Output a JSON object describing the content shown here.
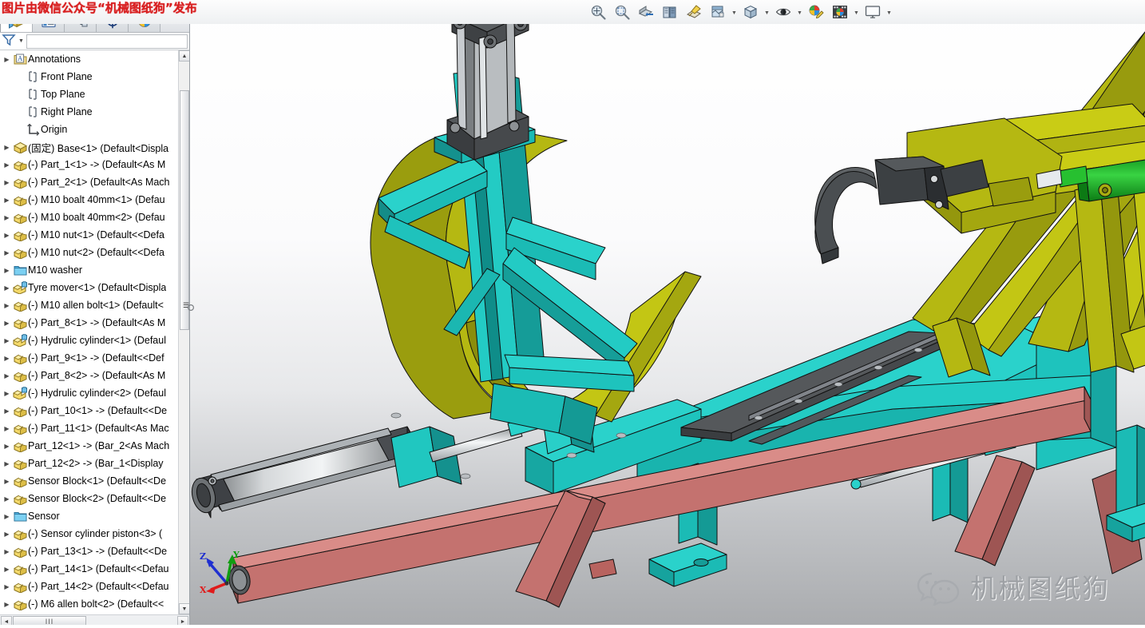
{
  "banner": {
    "text": "图片由微信公众号“机械图纸狗”发布",
    "color": "#d81f20"
  },
  "toolbar": {
    "buttons": [
      {
        "name": "zoom-to-fit-icon",
        "label": "Zoom to Fit",
        "glyph": "zoom-fit"
      },
      {
        "name": "zoom-to-area-icon",
        "label": "Zoom to Area",
        "glyph": "zoom-area"
      },
      {
        "name": "section-view-icon",
        "label": "Section View",
        "glyph": "section"
      },
      {
        "name": "view-orientation-icon",
        "label": "View Orientation",
        "glyph": "orientation"
      },
      {
        "name": "display-style-icon",
        "label": "Display Style",
        "glyph": "display-style"
      },
      {
        "name": "apply-scene-icon",
        "label": "Apply Scene",
        "glyph": "scene"
      },
      {
        "name": "hide-show-items-icon",
        "label": "Hide/Show Items",
        "glyph": "hide-show"
      },
      {
        "name": "edit-appearance-icon",
        "label": "Edit Appearance",
        "glyph": "appearance"
      },
      {
        "name": "view-settings-icon",
        "label": "View Settings",
        "glyph": "view-settings"
      },
      {
        "name": "viewport-icon",
        "label": "Viewport",
        "glyph": "viewport"
      }
    ]
  },
  "tree_panel": {
    "tabs": [
      {
        "name": "tab-feature-manager",
        "label": "FeatureManager design tree",
        "active": true
      },
      {
        "name": "tab-property-manager",
        "label": "PropertyManager",
        "active": false
      },
      {
        "name": "tab-configuration-manager",
        "label": "ConfigurationManager",
        "active": false
      },
      {
        "name": "tab-dimxpert-manager",
        "label": "DimXpertManager",
        "active": false
      },
      {
        "name": "tab-display-manager",
        "label": "DisplayManager",
        "active": false
      }
    ],
    "tabs_overflow_label": "›",
    "filter": {
      "placeholder": "",
      "value": "",
      "icon_label": "filter-icon"
    },
    "scroll": {
      "h_thumb_grip": "III",
      "up_arrow": "▲",
      "down_arrow": "▼",
      "left_arrow": "◄",
      "right_arrow": "►"
    },
    "items": [
      {
        "label": "Annotations",
        "icon": "folder-annotations",
        "expandable": true,
        "indent": 0
      },
      {
        "label": "Front Plane",
        "icon": "plane",
        "expandable": false,
        "indent": 1
      },
      {
        "label": "Top Plane",
        "icon": "plane",
        "expandable": false,
        "indent": 1
      },
      {
        "label": "Right Plane",
        "icon": "plane",
        "expandable": false,
        "indent": 1
      },
      {
        "label": "Origin",
        "icon": "origin",
        "expandable": false,
        "indent": 1
      },
      {
        "label": "(固定) Base<1> (Default<Displa",
        "icon": "part-fixed",
        "expandable": true,
        "indent": 0
      },
      {
        "label": "(-) Part_1<1> -> (Default<As M",
        "icon": "part",
        "expandable": true,
        "indent": 0
      },
      {
        "label": "(-) Part_2<1> (Default<As Mach",
        "icon": "part",
        "expandable": true,
        "indent": 0
      },
      {
        "label": "(-) M10 boalt 40mm<1> (Defau",
        "icon": "part",
        "expandable": true,
        "indent": 0
      },
      {
        "label": "(-) M10 boalt 40mm<2> (Defau",
        "icon": "part",
        "expandable": true,
        "indent": 0
      },
      {
        "label": "(-) M10 nut<1> (Default<<Defa",
        "icon": "part",
        "expandable": true,
        "indent": 0
      },
      {
        "label": "(-) M10 nut<2> (Default<<Defa",
        "icon": "part",
        "expandable": true,
        "indent": 0
      },
      {
        "label": "M10 washer",
        "icon": "folder",
        "expandable": true,
        "indent": 0
      },
      {
        "label": "Tyre mover<1> (Default<Displa",
        "icon": "subassembly",
        "expandable": true,
        "indent": 0
      },
      {
        "label": "(-) M10 allen bolt<1> (Default<",
        "icon": "part",
        "expandable": true,
        "indent": 0
      },
      {
        "label": "(-) Part_8<1> -> (Default<As M",
        "icon": "part",
        "expandable": true,
        "indent": 0
      },
      {
        "label": "(-) Hydrulic cylinder<1> (Defaul",
        "icon": "subassembly",
        "expandable": true,
        "indent": 0
      },
      {
        "label": "(-) Part_9<1> -> (Default<<Def",
        "icon": "part",
        "expandable": true,
        "indent": 0
      },
      {
        "label": "(-) Part_8<2> -> (Default<As M",
        "icon": "part",
        "expandable": true,
        "indent": 0
      },
      {
        "label": "(-) Hydrulic cylinder<2> (Defaul",
        "icon": "subassembly",
        "expandable": true,
        "indent": 0
      },
      {
        "label": "(-) Part_10<1> -> (Default<<De",
        "icon": "part",
        "expandable": true,
        "indent": 0
      },
      {
        "label": "(-) Part_11<1> (Default<As Mac",
        "icon": "part",
        "expandable": true,
        "indent": 0
      },
      {
        "label": "Part_12<1> -> (Bar_2<As Mach",
        "icon": "part",
        "expandable": true,
        "indent": 0
      },
      {
        "label": "Part_12<2> -> (Bar_1<Display ",
        "icon": "part",
        "expandable": true,
        "indent": 0
      },
      {
        "label": "Sensor Block<1> (Default<<De",
        "icon": "part",
        "expandable": true,
        "indent": 0
      },
      {
        "label": "Sensor Block<2> (Default<<De",
        "icon": "part",
        "expandable": true,
        "indent": 0
      },
      {
        "label": "Sensor",
        "icon": "folder",
        "expandable": true,
        "indent": 0
      },
      {
        "label": "(-) Sensor cylinder piston<3> (",
        "icon": "part",
        "expandable": true,
        "indent": 0
      },
      {
        "label": "(-) Part_13<1> -> (Default<<De",
        "icon": "part",
        "expandable": true,
        "indent": 0
      },
      {
        "label": "(-) Part_14<1> (Default<<Defau",
        "icon": "part",
        "expandable": true,
        "indent": 0
      },
      {
        "label": "(-) Part_14<2> (Default<<Defau",
        "icon": "part",
        "expandable": true,
        "indent": 0
      },
      {
        "label": "(-) M6 allen bolt<2> (Default<<",
        "icon": "part",
        "expandable": true,
        "indent": 0
      }
    ]
  },
  "viewport": {
    "triad": {
      "x_label": "X",
      "x_color": "#e01b1b",
      "y_label": "Y",
      "y_color": "#119e11",
      "z_label": "Z",
      "z_color": "#1f2fd0"
    },
    "model_colors": {
      "teal_frame": "#1fbfba",
      "teal_dark": "#14918e",
      "olive_arm": "#b8bb12",
      "olive_dark": "#8e9010",
      "olive_mid": "#a3a60f",
      "red_beam": "#c2706e",
      "red_beam_dark": "#9e5553",
      "green_cylinder": "#14b81f",
      "gray_metal": "#9a9da0",
      "gray_dark": "#45484b",
      "outline": "#1a1a1a"
    },
    "background": {
      "top": "#ffffff",
      "bottom": "#a9abae"
    }
  },
  "watermark": {
    "text": "机械图纸狗",
    "logo": "wechat-logo",
    "color": "#9ea1a5"
  }
}
